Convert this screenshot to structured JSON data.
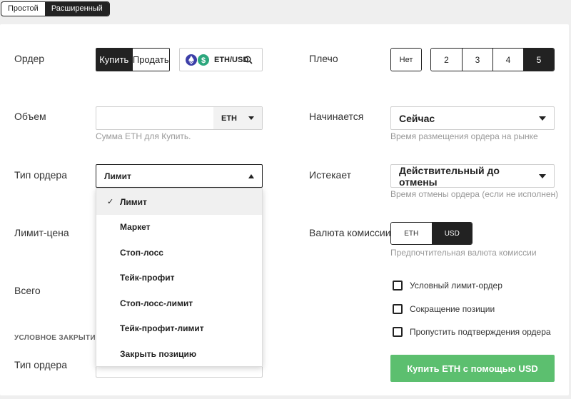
{
  "mode": {
    "simple": "Простой",
    "advanced": "Расширенный"
  },
  "order": {
    "label": "Ордер",
    "buy": "Купить",
    "sell": "Продать",
    "pair": "ETH/USD"
  },
  "leverage": {
    "label": "Плечо",
    "none": "Нет",
    "options": [
      "2",
      "3",
      "4",
      "5"
    ]
  },
  "volume": {
    "label": "Объем",
    "currency": "ETH",
    "hint": "Сумма ETH для Купить.",
    "value": ""
  },
  "starts": {
    "label": "Начинается",
    "value": "Сейчас",
    "hint": "Время размещения ордера на рынке"
  },
  "order_type": {
    "label": "Тип ордера",
    "value": "Лимит"
  },
  "expires": {
    "label": "Истекает",
    "value": "Действительный до отмены",
    "hint": "Время отмены ордера (если не исполнен)"
  },
  "dropdown": {
    "items": [
      "Лимит",
      "Маркет",
      "Стоп-лосс",
      "Тейк-профит",
      "Стоп-лосс-лимит",
      "Тейк-профит-лимит",
      "Закрыть позицию"
    ],
    "check": "✓"
  },
  "limit_price": {
    "label": "Лимит-цена"
  },
  "fee_currency": {
    "label": "Валюта комиссии",
    "eth": "ETH",
    "usd": "USD",
    "hint": "Предпочтительная валюта комиссии"
  },
  "total": {
    "label": "Всего"
  },
  "conditional_close": {
    "label": "УСЛОВНОЕ ЗАКРЫТИЕ",
    "order_type_label": "Тип ордера"
  },
  "checkboxes": [
    "Условный лимит-ордер",
    "Сокращение позиции",
    "Пропустить подтверждения ордера"
  ],
  "submit": "Купить ETH с помощью USD",
  "colors": {
    "submit": "#5cbf6f",
    "eth_icon": "#3c3fa8",
    "usd_icon": "#2ca77d"
  }
}
